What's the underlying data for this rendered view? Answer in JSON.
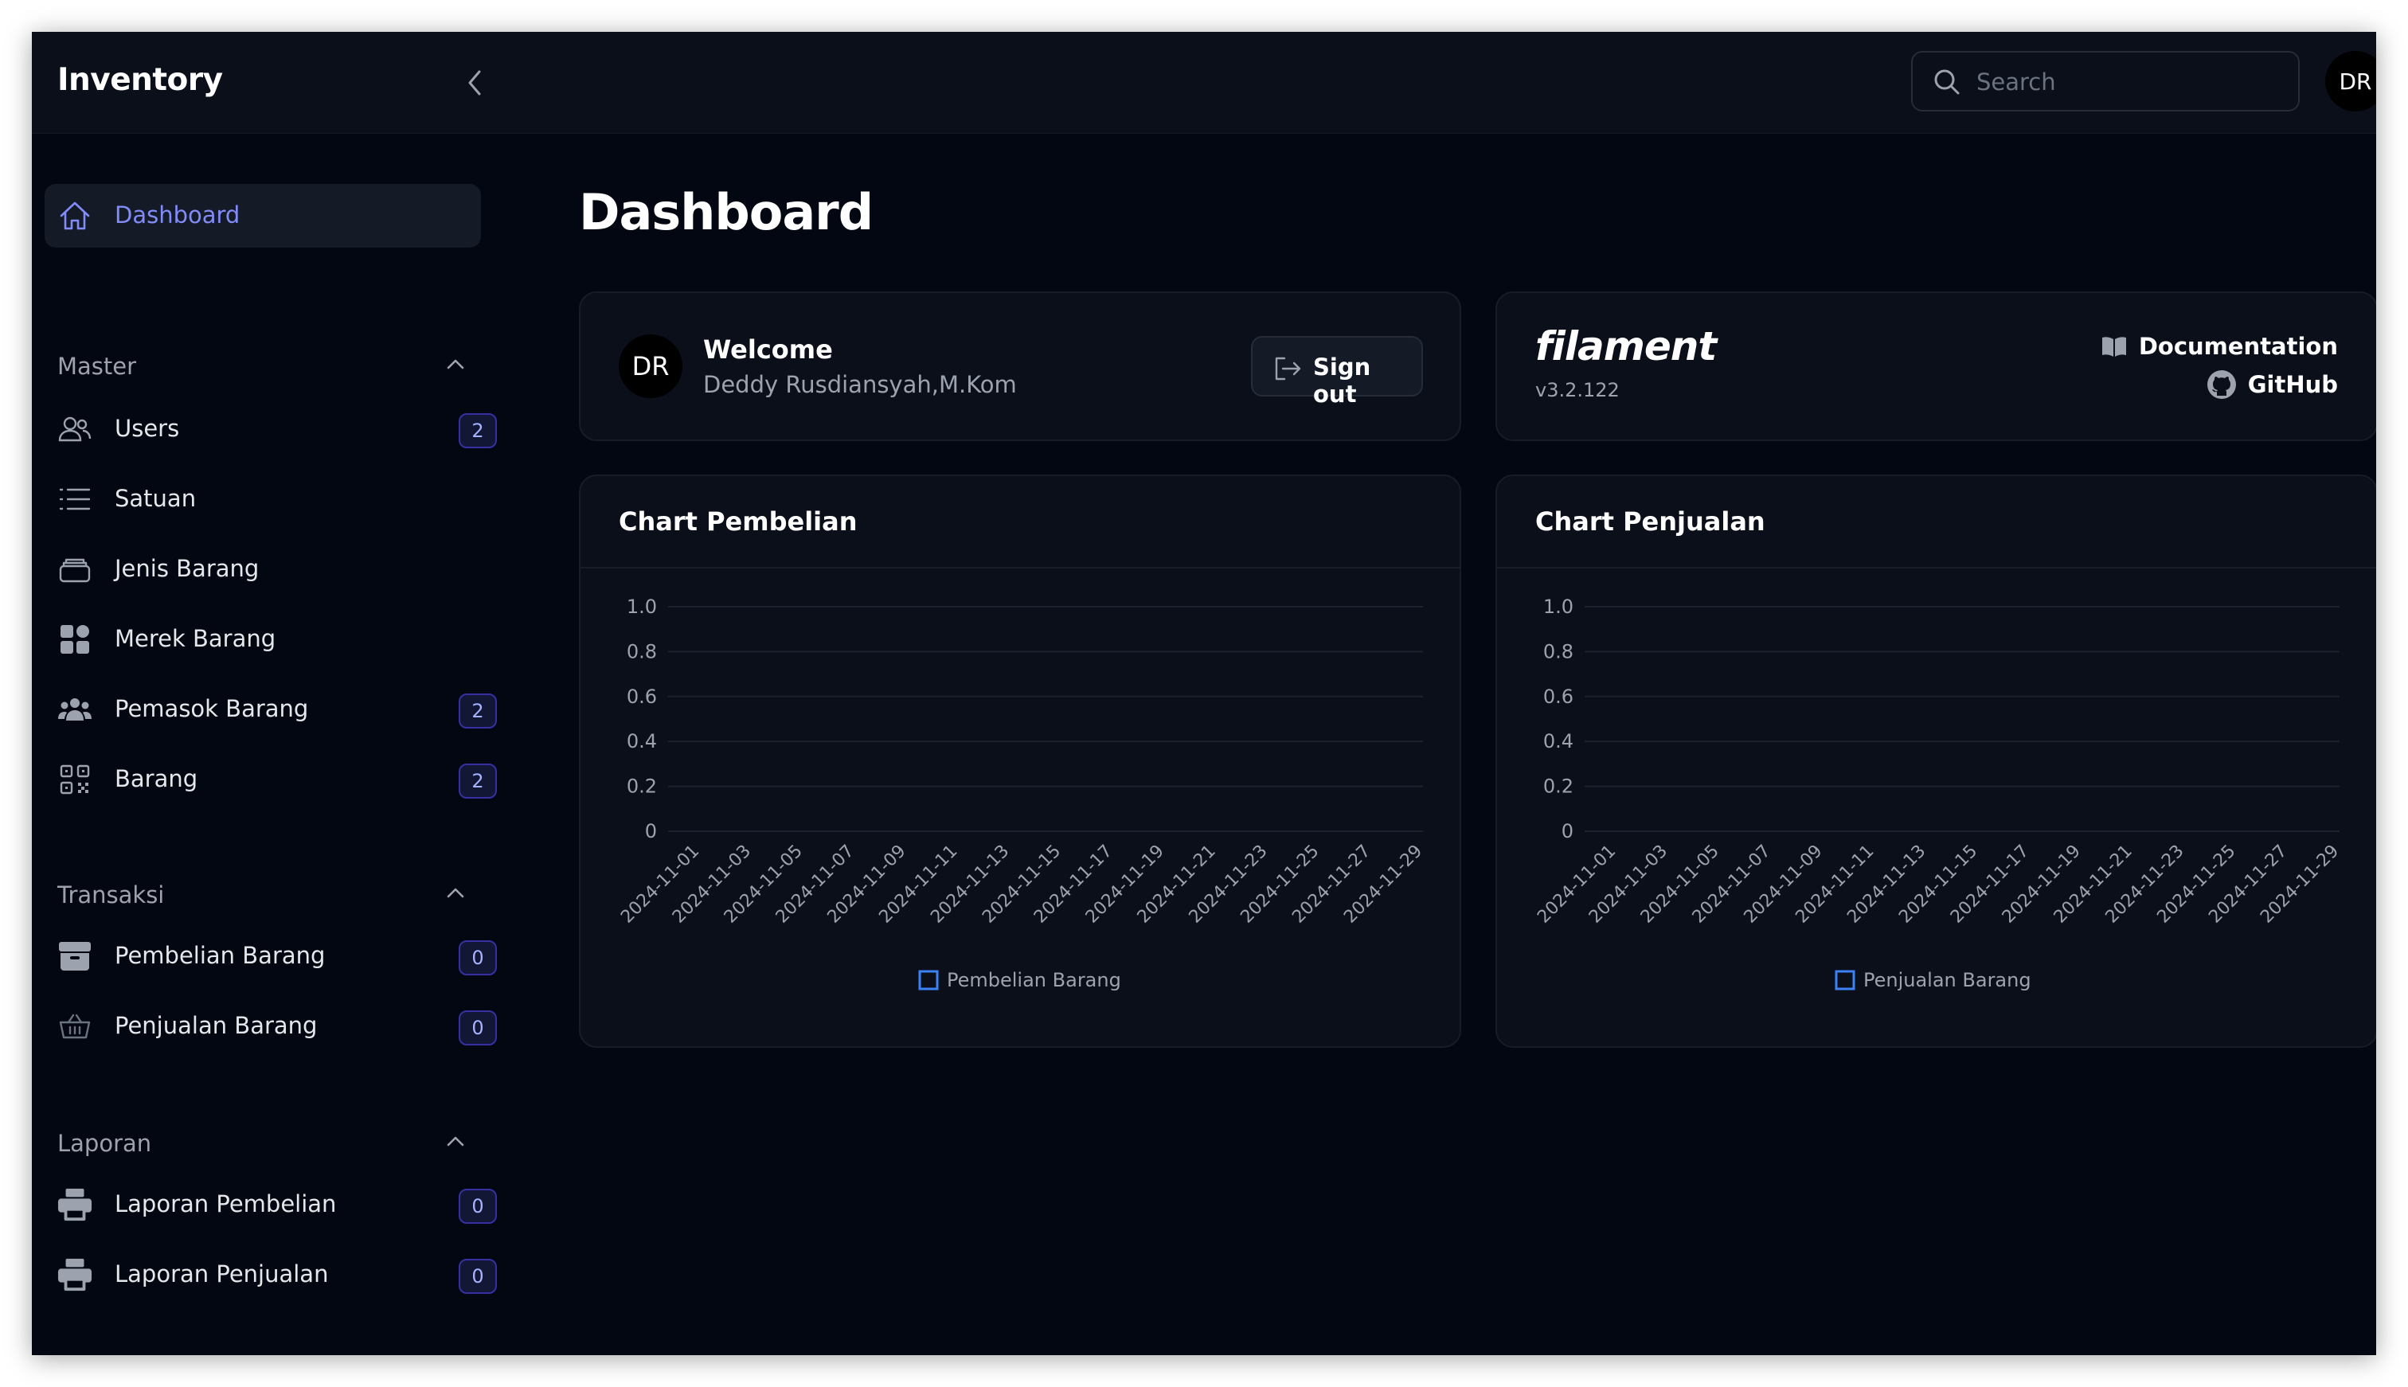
{
  "app": {
    "title": "Inventory"
  },
  "topbar": {
    "search_placeholder": "Search",
    "user_initials": "DR"
  },
  "sidebar": {
    "dashboard": {
      "label": "Dashboard"
    },
    "groups": [
      {
        "title": "Master",
        "items": [
          {
            "label": "Users",
            "badge": "2",
            "icon": "users-icon"
          },
          {
            "label": "Satuan",
            "badge": "",
            "icon": "list-icon"
          },
          {
            "label": "Jenis Barang",
            "badge": "",
            "icon": "stack-icon"
          },
          {
            "label": "Merek Barang",
            "badge": "",
            "icon": "grid-icon"
          },
          {
            "label": "Pemasok Barang",
            "badge": "2",
            "icon": "user-group-icon"
          },
          {
            "label": "Barang",
            "badge": "2",
            "icon": "qr-code-icon"
          }
        ]
      },
      {
        "title": "Transaksi",
        "items": [
          {
            "label": "Pembelian Barang",
            "badge": "0",
            "icon": "box-icon"
          },
          {
            "label": "Penjualan Barang",
            "badge": "0",
            "icon": "basket-icon"
          }
        ]
      },
      {
        "title": "Laporan",
        "items": [
          {
            "label": "Laporan Pembelian",
            "badge": "0",
            "icon": "printer-icon"
          },
          {
            "label": "Laporan Penjualan",
            "badge": "0",
            "icon": "printer-icon"
          }
        ]
      }
    ]
  },
  "main": {
    "title": "Dashboard",
    "welcome": {
      "heading": "Welcome",
      "name": "Deddy Rusdiansyah,M.Kom",
      "initials": "DR",
      "signout_label": "Sign out"
    },
    "filament": {
      "logo": "filament",
      "version": "v3.2.122",
      "docs_label": "Documentation",
      "github_label": "GitHub"
    }
  },
  "colors": {
    "accent": "#818cf8",
    "series": "#3b82f6",
    "background": "#030711",
    "card": "#0b0f19"
  },
  "chart_data": [
    {
      "type": "line",
      "title": "Chart Pembelian",
      "x": [
        "2024-11-01",
        "2024-11-03",
        "2024-11-05",
        "2024-11-07",
        "2024-11-09",
        "2024-11-11",
        "2024-11-13",
        "2024-11-15",
        "2024-11-17",
        "2024-11-19",
        "2024-11-21",
        "2024-11-23",
        "2024-11-25",
        "2024-11-27",
        "2024-11-29"
      ],
      "yticks": [
        "1.0",
        "0.8",
        "0.6",
        "0.4",
        "0.2",
        "0"
      ],
      "ylim": [
        0,
        1
      ],
      "series": [
        {
          "name": "Pembelian Barang",
          "values": []
        }
      ],
      "legend": "bottom-center",
      "grid": true
    },
    {
      "type": "line",
      "title": "Chart Penjualan",
      "x": [
        "2024-11-01",
        "2024-11-03",
        "2024-11-05",
        "2024-11-07",
        "2024-11-09",
        "2024-11-11",
        "2024-11-13",
        "2024-11-15",
        "2024-11-17",
        "2024-11-19",
        "2024-11-21",
        "2024-11-23",
        "2024-11-25",
        "2024-11-27",
        "2024-11-29"
      ],
      "yticks": [
        "1.0",
        "0.8",
        "0.6",
        "0.4",
        "0.2",
        "0"
      ],
      "ylim": [
        0,
        1
      ],
      "series": [
        {
          "name": "Penjualan Barang",
          "values": []
        }
      ],
      "legend": "bottom-center",
      "grid": true
    }
  ]
}
